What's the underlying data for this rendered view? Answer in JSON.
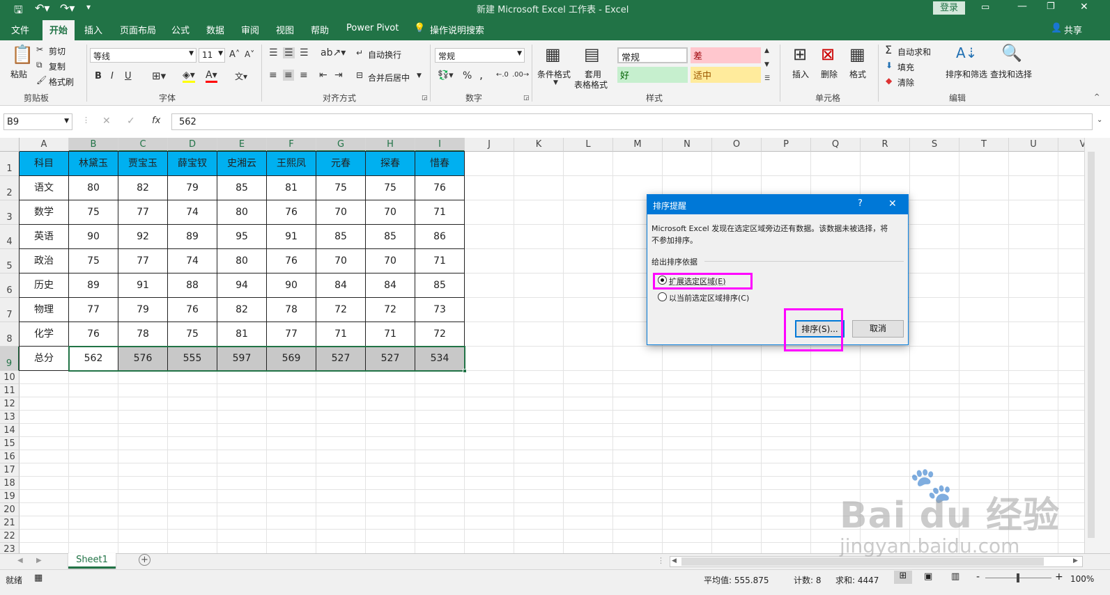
{
  "title_bar": {
    "title": "新建 Microsoft Excel 工作表  -  Excel",
    "login": "登录"
  },
  "tabs": [
    {
      "label": "文件"
    },
    {
      "label": "开始"
    },
    {
      "label": "插入"
    },
    {
      "label": "页面布局"
    },
    {
      "label": "公式"
    },
    {
      "label": "数据"
    },
    {
      "label": "审阅"
    },
    {
      "label": "视图"
    },
    {
      "label": "帮助"
    },
    {
      "label": "Power Pivot"
    },
    {
      "label": "操作说明搜索"
    }
  ],
  "share": "共享",
  "ribbon": {
    "clipboard": {
      "paste": "粘贴",
      "cut": "剪切",
      "copy": "复制",
      "format_painter": "格式刷",
      "label": "剪贴板"
    },
    "font": {
      "font_name": "等线",
      "font_size": "11",
      "bold": "B",
      "italic": "I",
      "underline": "U",
      "label": "字体"
    },
    "alignment": {
      "wrap": "自动换行",
      "merge": "合并后居中",
      "label": "对齐方式"
    },
    "number": {
      "format": "常规",
      "percent": "%",
      "comma": ",",
      "label": "数字"
    },
    "styles": {
      "conditional": "条件格式",
      "table_format_1": "套用",
      "table_format_2": "表格格式",
      "normal": "常规",
      "bad": "差",
      "good": "好",
      "neutral": "适中",
      "label": "样式"
    },
    "cells": {
      "insert": "插入",
      "delete": "删除",
      "format": "格式",
      "label": "单元格"
    },
    "editing": {
      "autosum": "自动求和",
      "fill": "填充",
      "clear": "清除",
      "sort_filter": "排序和筛选",
      "find_select": "查找和选择",
      "label": "编辑"
    }
  },
  "formula_bar": {
    "name_box": "B9",
    "fx": "fx",
    "value": "562"
  },
  "columns": [
    "A",
    "B",
    "C",
    "D",
    "E",
    "F",
    "G",
    "H",
    "I",
    "J",
    "K",
    "L",
    "M",
    "N",
    "O",
    "P",
    "Q",
    "R",
    "S",
    "T",
    "U",
    "V"
  ],
  "rows": [
    "1",
    "2",
    "3",
    "4",
    "5",
    "6",
    "7",
    "8",
    "9",
    "10",
    "11",
    "12",
    "13",
    "14",
    "15",
    "16",
    "17",
    "18",
    "19",
    "20",
    "21",
    "22",
    "23"
  ],
  "table": {
    "header": [
      "科目",
      "林黛玉",
      "贾宝玉",
      "薛宝钗",
      "史湘云",
      "王熙凤",
      "元春",
      "探春",
      "惜春"
    ],
    "rows": [
      [
        "语文",
        "80",
        "82",
        "79",
        "85",
        "81",
        "75",
        "75",
        "76"
      ],
      [
        "数学",
        "75",
        "77",
        "74",
        "80",
        "76",
        "70",
        "70",
        "71"
      ],
      [
        "英语",
        "90",
        "92",
        "89",
        "95",
        "91",
        "85",
        "85",
        "86"
      ],
      [
        "政治",
        "75",
        "77",
        "74",
        "80",
        "76",
        "70",
        "70",
        "71"
      ],
      [
        "历史",
        "89",
        "91",
        "88",
        "94",
        "90",
        "84",
        "84",
        "85"
      ],
      [
        "物理",
        "77",
        "79",
        "76",
        "82",
        "78",
        "72",
        "72",
        "73"
      ],
      [
        "化学",
        "76",
        "78",
        "75",
        "81",
        "77",
        "71",
        "71",
        "72"
      ],
      [
        "总分",
        "562",
        "576",
        "555",
        "597",
        "569",
        "527",
        "527",
        "534"
      ]
    ]
  },
  "colors": {
    "excel_green": "#217346",
    "table_header_fill": "#00b0f0",
    "selection_fill": "#c8c8c8",
    "dialog_blue": "#0078d7",
    "highlight_magenta": "#ff00ff",
    "bad_fill": "#ffc7ce",
    "good_fill": "#c6efce",
    "neutral_fill": "#ffeb9c"
  },
  "dialog": {
    "title": "排序提醒",
    "help": "?",
    "close": "✕",
    "message_line1": "Microsoft Excel 发现在选定区域旁边还有数据。该数据未被选择，将",
    "message_line2": "不参加排序。",
    "section": "给出排序依据",
    "option_expand": "扩展选定区域(E)",
    "option_current": "以当前选定区域排序(C)",
    "sort_button": "排序(S)...",
    "cancel_button": "取消"
  },
  "sheet_tabs": {
    "active": "Sheet1",
    "add": "+"
  },
  "status": {
    "ready": "就绪",
    "average": "平均值: 555.875",
    "count": "计数: 8",
    "sum": "求和: 4447",
    "zoom": "100%",
    "zoom_minus": "-",
    "zoom_plus": "+"
  },
  "watermark": {
    "brand": "Bai  du 经验",
    "url": "jingyan.baidu.com"
  }
}
